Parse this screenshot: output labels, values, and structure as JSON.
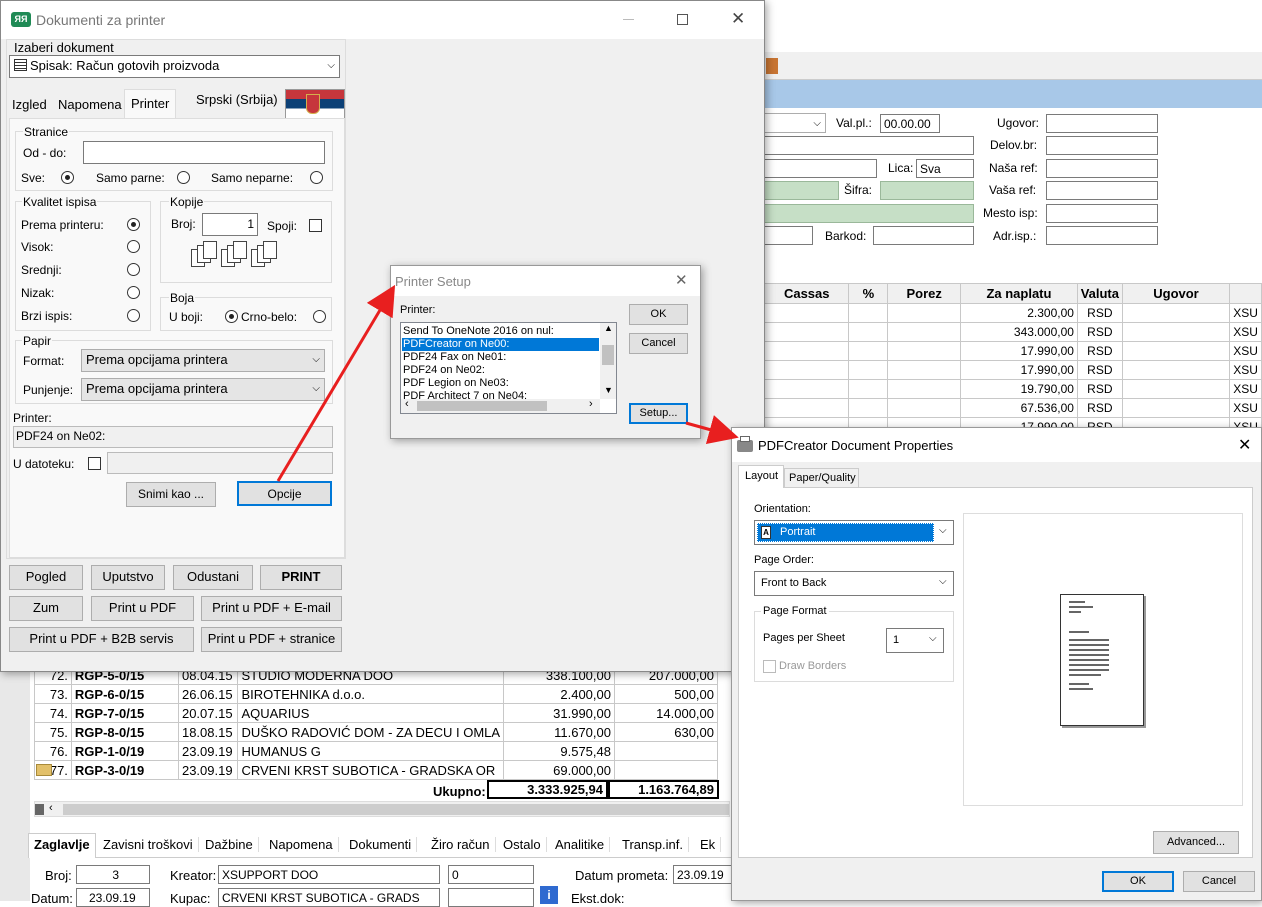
{
  "dialog": {
    "title": "Dokumenti za printer",
    "select_label": "Izaberi dokument",
    "document": "Spisak: Račun gotovih proizvoda",
    "tabs": [
      "Izgled",
      "Napomena",
      "Printer"
    ],
    "language": "Srpski (Srbija)",
    "stranice": {
      "title": "Stranice",
      "od_do": "Od - do:",
      "sve": "Sve:",
      "parne": "Samo parne:",
      "neparne": "Samo neparne:"
    },
    "kvalitet": {
      "title": "Kvalitet ispisa",
      "items": [
        "Prema printeru:",
        "Visok:",
        "Srednji:",
        "Nizak:",
        "Brzi ispis:"
      ]
    },
    "kopije": {
      "title": "Kopije",
      "broj": "Broj:",
      "broj_value": "1",
      "spoji": "Spoji:"
    },
    "boja": {
      "title": "Boja",
      "u_boji": "U boji:",
      "crno": "Crno-belo:"
    },
    "papir": {
      "title": "Papir",
      "format": "Format:",
      "format_value": "Prema opcijama printera",
      "punjenje": "Punjenje:",
      "punjenje_value": "Prema opcijama printera"
    },
    "printer_label": "Printer:",
    "printer_value": "PDF24 on Ne02:",
    "datoteka": "U datoteku:",
    "snimi": "Snimi kao ...",
    "opcije": "Opcije",
    "buttons": [
      "Pogled",
      "Uputstvo",
      "Odustani",
      "PRINT",
      "Zum",
      "Print u PDF",
      "Print u PDF + E-mail",
      "Print u PDF + B2B servis",
      "Print u PDF + stranice"
    ]
  },
  "setup": {
    "title": "Printer Setup",
    "printer_label": "Printer:",
    "list": [
      "Send To OneNote 2016 on nul:",
      "PDFCreator on Ne00:",
      "PDF24 Fax on Ne01:",
      "PDF24 on Ne02:",
      "PDF Legion on Ne03:",
      "PDF Architect 7 on Ne04:"
    ],
    "selected": 1,
    "ok": "OK",
    "cancel": "Cancel",
    "setup": "Setup..."
  },
  "props": {
    "title": "PDFCreator Document Properties",
    "tabs": [
      "Layout",
      "Paper/Quality"
    ],
    "orientation_label": "Orientation:",
    "orientation": "Portrait",
    "page_order_label": "Page Order:",
    "page_order": "Front to Back",
    "page_format": "Page Format",
    "pps_label": "Pages per Sheet",
    "pps": "1",
    "draw_borders": "Draw Borders",
    "advanced": "Advanced...",
    "ok": "OK",
    "cancel": "Cancel"
  },
  "bg": {
    "form": {
      "valpl": "Val.pl.:",
      "valpl_value": "00.00.00",
      "ugovor": "Ugovor:",
      "delov": "Delov.br:",
      "lica": "Lica:",
      "lica_value": "Sva",
      "nasa": "Naša ref:",
      "sifra": "Šifra:",
      "vasa": "Vaša ref:",
      "mesto": "Mesto isp:",
      "barkod": "Barkod:",
      "adr": "Adr.isp.:"
    },
    "grid_headers": [
      "Cassas",
      "%",
      "Porez",
      "Za naplatu",
      "Valuta",
      "Ugovor"
    ],
    "grid_rows": [
      [
        "2.300,00",
        "RSD",
        "XSU"
      ],
      [
        "343.000,00",
        "RSD",
        "XSU"
      ],
      [
        "17.990,00",
        "RSD",
        "XSU"
      ],
      [
        "17.990,00",
        "RSD",
        "XSU"
      ],
      [
        "19.790,00",
        "RSD",
        "XSU"
      ],
      [
        "67.536,00",
        "RSD",
        "XSU"
      ],
      [
        "17.990,00",
        "RSD",
        "XSU"
      ]
    ],
    "rows": [
      [
        "72.",
        "RGP-5-0/15",
        "08.04.15",
        "STUDIO MODERNA DOO",
        "338.100,00",
        "207.000,00"
      ],
      [
        "73.",
        "RGP-6-0/15",
        "26.06.15",
        "BIROTEHNIKA d.o.o.",
        "2.400,00",
        "500,00"
      ],
      [
        "74.",
        "RGP-7-0/15",
        "20.07.15",
        "AQUARIUS",
        "31.990,00",
        "14.000,00"
      ],
      [
        "75.",
        "RGP-8-0/15",
        "18.08.15",
        "DUŠKO RADOVIĆ DOM - ZA DECU I OMLA",
        "11.670,00",
        "630,00"
      ],
      [
        "76.",
        "RGP-1-0/19",
        "23.09.19",
        "HUMANUS G",
        "9.575,48",
        ""
      ],
      [
        "77.",
        "RGP-3-0/19",
        "23.09.19",
        "CRVENI KRST SUBOTICA  -  GRADSKA  OR",
        "69.000,00",
        ""
      ]
    ],
    "ukupno": "Ukupno:",
    "total1": "3.333.925,94",
    "total2": "1.163.764,89",
    "bottom_tabs": [
      "Zaglavlje",
      "Zavisni troškovi",
      "Dažbine",
      "Napomena",
      "Dokumenti",
      "Žiro račun",
      "Ostalo",
      "Analitike",
      "Transp.inf.",
      "Ek"
    ],
    "broj": "Broj:",
    "broj_value": "3",
    "kreator": "Kreator:",
    "kreator_value": "XSUPPORT DOO",
    "field0": "0",
    "datum_prometa": "Datum prometa:",
    "datum_prometa_value": "23.09.19",
    "datum": "Datum:",
    "datum_value": "23.09.19",
    "kupac": "Kupac:",
    "kupac_value": "CRVENI KRST SUBOTICA  -  GRADS",
    "ekst": "Ekst.dok:"
  }
}
